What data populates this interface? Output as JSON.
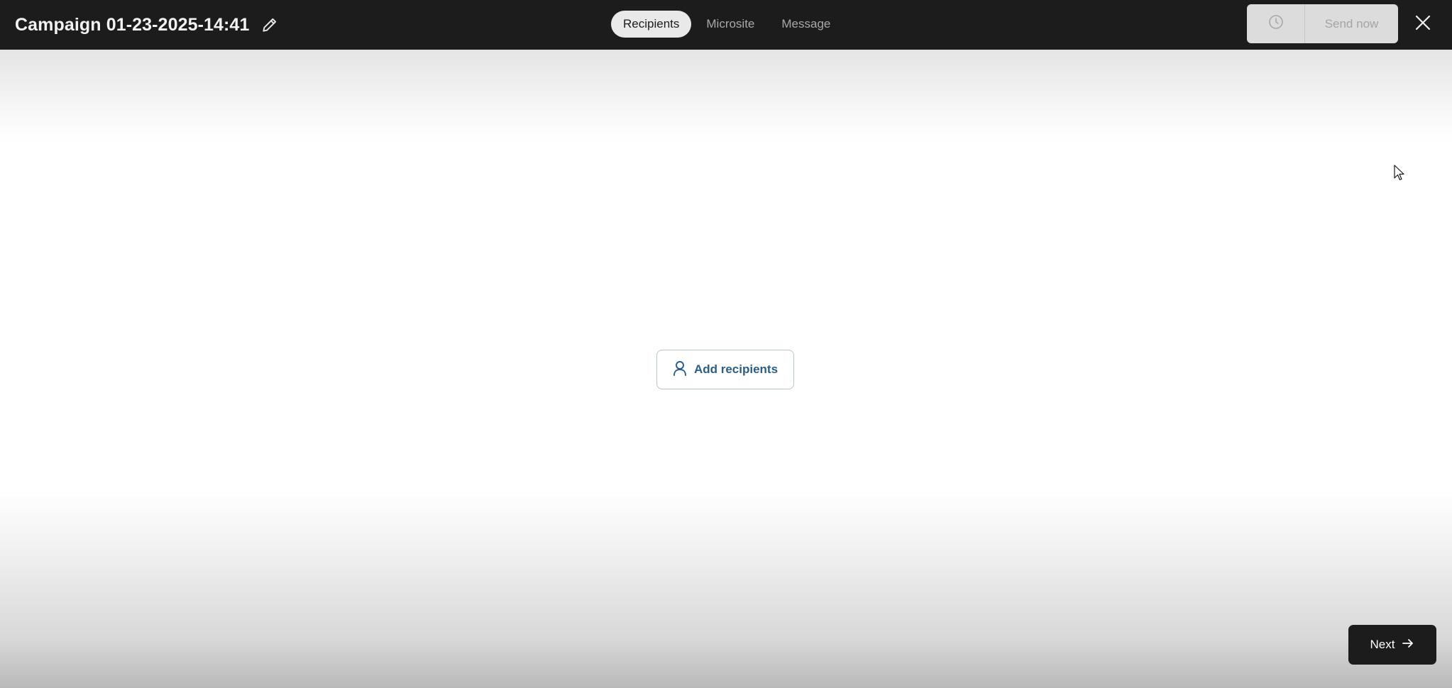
{
  "header": {
    "campaign_title": "Campaign 01-23-2025-14:41",
    "tabs": [
      {
        "label": "Recipients",
        "active": true
      },
      {
        "label": "Microsite",
        "active": false
      },
      {
        "label": "Message",
        "active": false
      }
    ],
    "send_now_label": "Send now",
    "icons": {
      "edit": "pencil-icon",
      "schedule": "clock-icon",
      "close": "close-icon"
    }
  },
  "main": {
    "add_recipients_label": "Add recipients",
    "add_recipients_icon": "user-icon"
  },
  "footer": {
    "next_label": "Next",
    "next_icon": "arrow-right-icon"
  },
  "colors": {
    "topbar_bg": "#1c1c1c",
    "accent_text": "#2b5d86",
    "disabled_bg": "#dcdcdc"
  }
}
